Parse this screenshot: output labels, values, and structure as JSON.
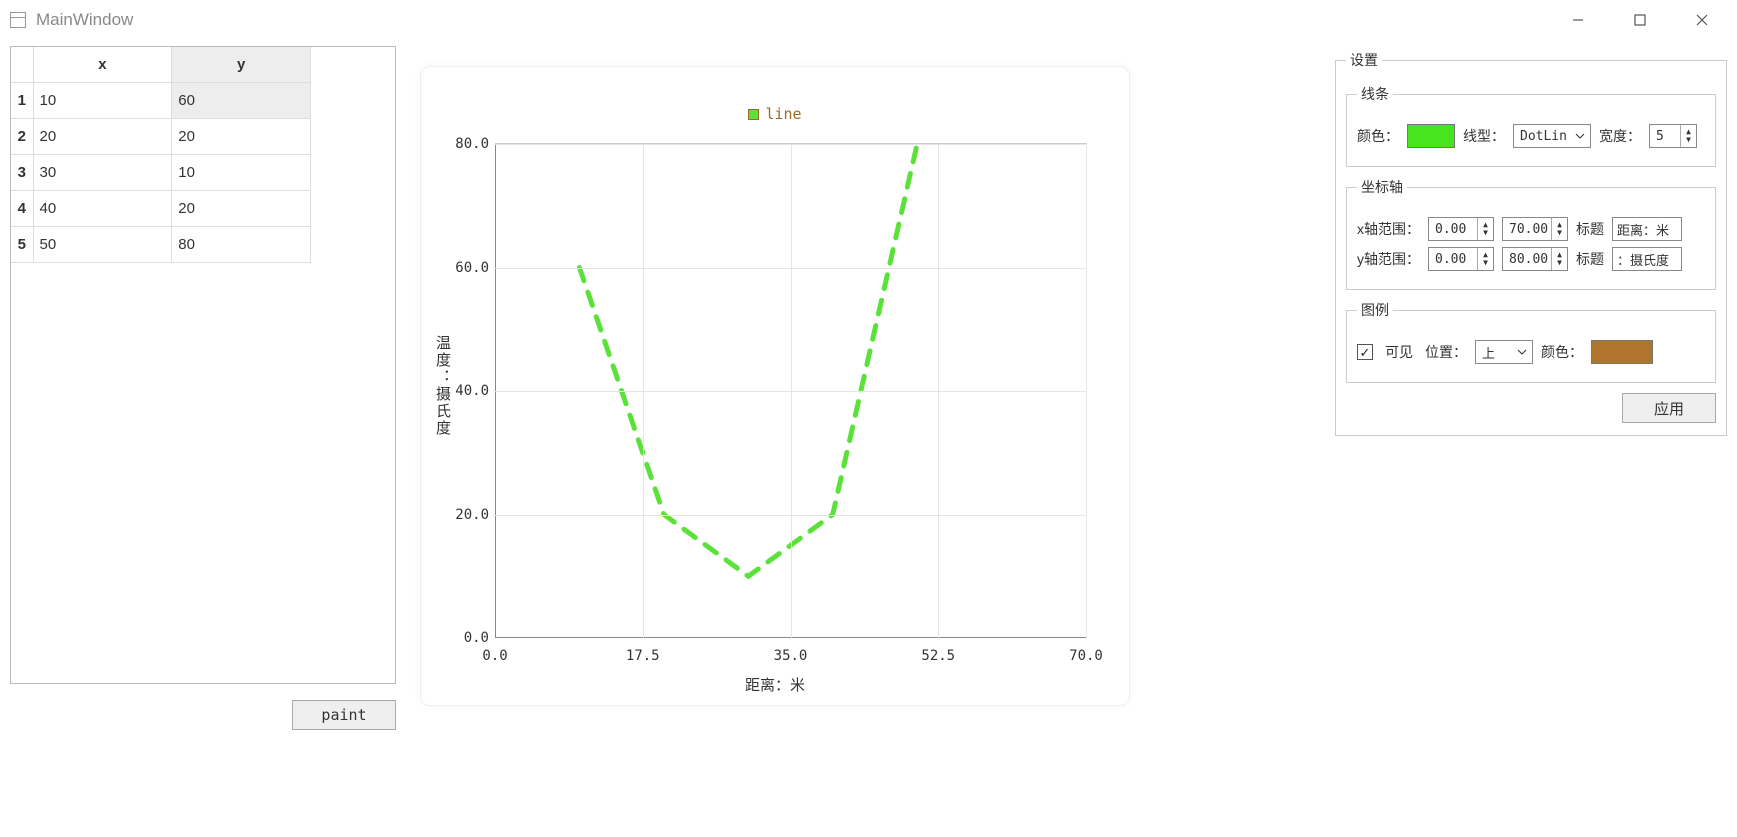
{
  "window": {
    "title": "MainWindow"
  },
  "table": {
    "headers": [
      "x",
      "y"
    ],
    "rows": [
      {
        "n": "1",
        "x": "10",
        "y": "60"
      },
      {
        "n": "2",
        "x": "20",
        "y": "20"
      },
      {
        "n": "3",
        "x": "30",
        "y": "10"
      },
      {
        "n": "4",
        "x": "40",
        "y": "20"
      },
      {
        "n": "5",
        "x": "50",
        "y": "80"
      }
    ],
    "selected_row_index": 0
  },
  "paint_button": "paint",
  "chart_data": {
    "type": "line",
    "series": [
      {
        "name": "line",
        "x": [
          10,
          20,
          30,
          40,
          50
        ],
        "y": [
          60,
          20,
          10,
          20,
          80
        ]
      }
    ],
    "xlabel": "距离：米",
    "ylabel": "温度：摄氏度",
    "xlim": [
      0,
      70
    ],
    "ylim": [
      0,
      80
    ],
    "xticks": [
      0.0,
      17.5,
      35.0,
      52.5,
      70.0
    ],
    "yticks": [
      0.0,
      20.0,
      40.0,
      60.0,
      80.0
    ],
    "xtick_labels": [
      "0.0",
      "17.5",
      "35.0",
      "52.5",
      "70.0"
    ],
    "ytick_labels": [
      "0.0",
      "20.0",
      "40.0",
      "60.0",
      "80.0"
    ],
    "line_color": "#5ae23a",
    "line_style": "dashed",
    "line_width": 5,
    "legend": {
      "visible": true,
      "position": "top",
      "text_color": "#9a6a20"
    }
  },
  "settings": {
    "group_title": "设置",
    "line_group": {
      "title": "线条",
      "color_label": "颜色：",
      "color_value": "#46e61e",
      "style_label": "线型：",
      "style_value": "DotLin",
      "width_label": "宽度：",
      "width_value": "5"
    },
    "axis_group": {
      "title": "坐标轴",
      "x_range_label": "x轴范围：",
      "x_min": "0.00",
      "x_max": "70.00",
      "x_title_label": "标题",
      "x_title_value": "距离：米",
      "y_range_label": "y轴范围：",
      "y_min": "0.00",
      "y_max": "80.00",
      "y_title_label": "标题",
      "y_title_value": "：摄氏度"
    },
    "legend_group": {
      "title": "图例",
      "visible_label": "可见",
      "visible_checked": true,
      "position_label": "位置：",
      "position_value": "上",
      "color_label": "颜色：",
      "color_value": "#b0752c"
    },
    "apply_button": "应用"
  }
}
